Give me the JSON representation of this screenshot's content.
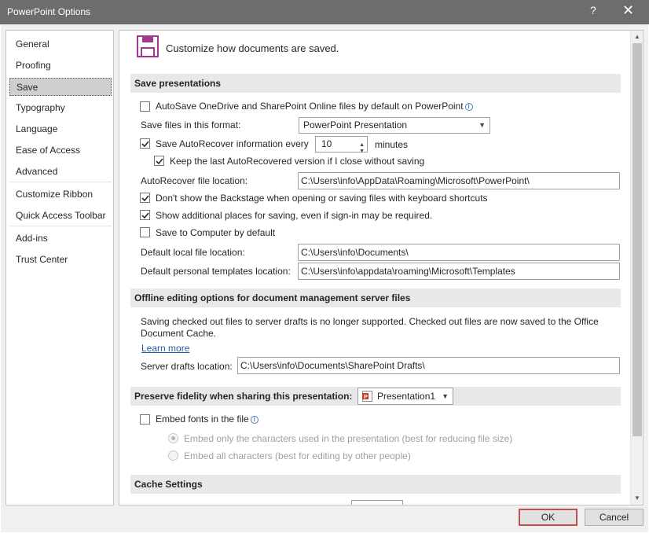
{
  "window": {
    "title": "PowerPoint Options",
    "help_icon": "?",
    "close_icon": "✕"
  },
  "nav": {
    "items": [
      "General",
      "Proofing",
      "Save",
      "Typography",
      "Language",
      "Ease of Access",
      "Advanced",
      "Customize Ribbon",
      "Quick Access Toolbar",
      "Add-ins",
      "Trust Center"
    ],
    "selected": "Save"
  },
  "header": {
    "text": "Customize how documents are saved.",
    "icon": "floppy-disk-icon"
  },
  "save_presentations": {
    "heading": "Save presentations",
    "autosave_label": "AutoSave OneDrive and SharePoint Online files by default on PowerPoint",
    "autosave_checked": false,
    "format_label": "Save files in this format:",
    "format_value": "PowerPoint Presentation",
    "autorecover_label": "Save AutoRecover information every",
    "autorecover_checked": true,
    "autorecover_minutes": "10",
    "minutes_label": "minutes",
    "keep_last_label": "Keep the last AutoRecovered version if I close without saving",
    "keep_last_checked": true,
    "autorecover_location_label": "AutoRecover file location:",
    "autorecover_location_value": "C:\\Users\\info\\AppData\\Roaming\\Microsoft\\PowerPoint\\",
    "backstage_label": "Don't show the Backstage when opening or saving files with keyboard shortcuts",
    "backstage_checked": true,
    "additional_places_label": "Show additional places for saving, even if sign-in may be required.",
    "additional_places_checked": true,
    "save_to_computer_label": "Save to Computer by default",
    "save_to_computer_checked": false,
    "default_local_label": "Default local file location:",
    "default_local_value": "C:\\Users\\info\\Documents\\",
    "default_templates_label": "Default personal templates location:",
    "default_templates_value": "C:\\Users\\info\\appdata\\roaming\\Microsoft\\Templates"
  },
  "offline": {
    "heading": "Offline editing options for document management server files",
    "description_line1": "Saving checked out files to server drafts is no longer supported. Checked out files are now saved to the Office",
    "description_line2": "Document Cache.",
    "learn_more": "Learn more",
    "drafts_label": "Server drafts location:",
    "drafts_value": "C:\\Users\\info\\Documents\\SharePoint Drafts\\"
  },
  "fidelity": {
    "heading": "Preserve fidelity when sharing this presentation:",
    "presentation": "Presentation1",
    "embed_fonts_label": "Embed fonts in the file",
    "embed_fonts_checked": false,
    "embed_only_label": "Embed only the characters used in the presentation (best for reducing file size)",
    "embed_all_label": "Embed all characters (best for editing by other people)"
  },
  "cache": {
    "heading": "Cache Settings"
  },
  "buttons": {
    "ok": "OK",
    "cancel": "Cancel"
  },
  "colors": {
    "titlebar": "#6d6d6d",
    "accent_border": "#c0504d",
    "link": "#1f5fa8",
    "floppy": "#a4378f"
  }
}
